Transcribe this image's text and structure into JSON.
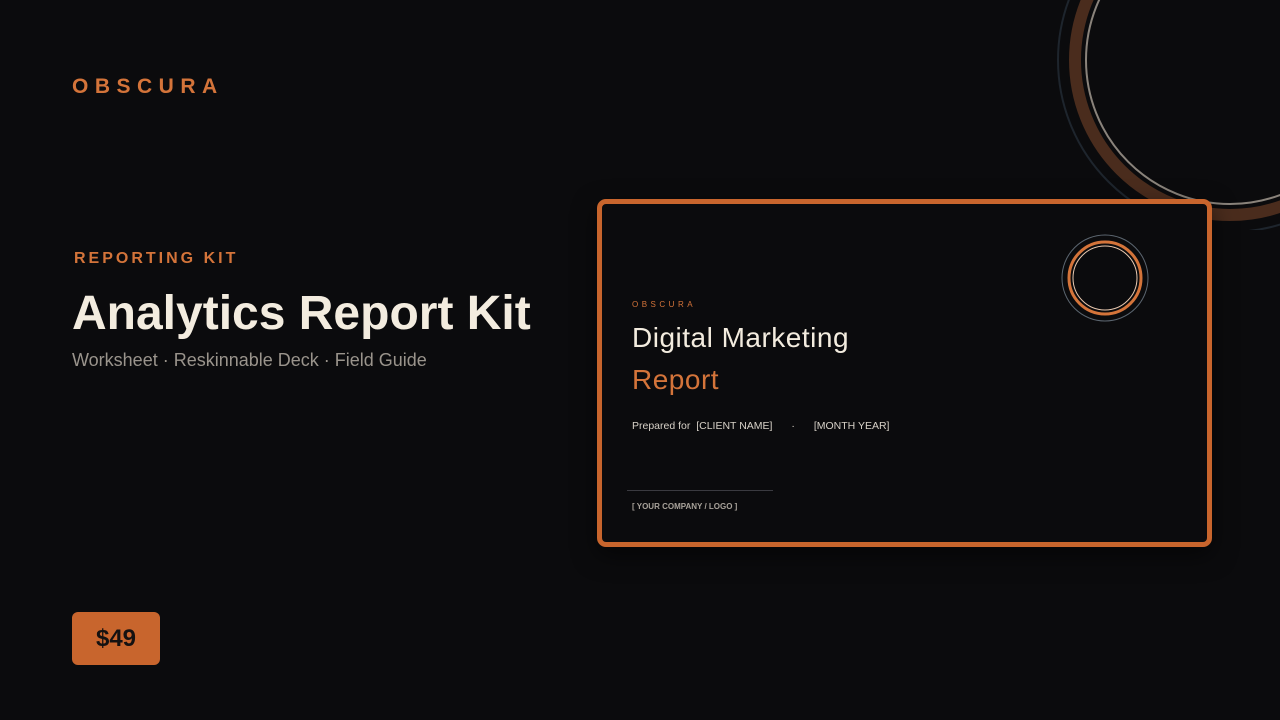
{
  "brand": "OBSCURA",
  "hero": {
    "eyebrow": "REPORTING KIT",
    "title": "Analytics Report Kit",
    "subtitle": "Worksheet · Reskinnable Deck · Field Guide"
  },
  "price": "$49",
  "preview_card": {
    "brand": "OBSCURA",
    "title": "Digital Marketing",
    "accent_title": "Report",
    "prepared_for_label": "Prepared for",
    "client_placeholder": "[CLIENT NAME]",
    "separator": "·",
    "date_placeholder": "[MONTH YEAR]",
    "logo_placeholder": "[ YOUR COMPANY / LOGO ]"
  },
  "colors": {
    "background": "#0b0b0d",
    "accent": "#d4743a",
    "accent_dark": "#c8652d",
    "text_primary": "#f3ecdf",
    "text_muted": "#9a948c",
    "ring_outline": "#2a323c"
  }
}
